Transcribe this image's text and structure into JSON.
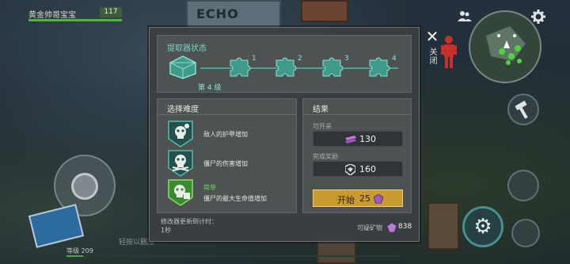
{
  "player": {
    "name": "黄金帅哥宝宝",
    "level": "117",
    "hp_fraction": 1.0
  },
  "world": {
    "building_sign": "ECHO"
  },
  "hud": {
    "close_label": "关闭",
    "level_text": "等级 209",
    "xp_fraction": 0.05,
    "hint_text": "轻按以删除"
  },
  "icons": {
    "friends": "friends-icon",
    "settings": "gear-icon",
    "close": "close-icon",
    "hammer": "hammer-icon",
    "craft": "craft-icon"
  },
  "extractor": {
    "title": "提取器状态",
    "current_level": "第 4 级",
    "stages": [
      "1",
      "2",
      "3",
      "4"
    ]
  },
  "difficulty": {
    "title": "选择难度",
    "options": [
      {
        "text": "敌人的护甲增加",
        "tag": ""
      },
      {
        "text": "僵尸的伤害增加",
        "tag": ""
      },
      {
        "text": "僵尸的最大生命值增加",
        "tag": "简单"
      }
    ]
  },
  "results": {
    "title": "结果",
    "minable_label": "可开采",
    "minable_value": "130",
    "reward_label": "完成奖励",
    "reward_value": "160",
    "start_label": "开始",
    "start_cost": "25"
  },
  "footer": {
    "refresh_label": "修改器更新倒计时：",
    "refresh_value": "1秒",
    "minerals_label": "可疑矿物",
    "minerals_value": "838"
  },
  "colors": {
    "accent_teal": "#48a596",
    "start_gold": "#c99a2f",
    "easy_green": "#72d65d"
  }
}
